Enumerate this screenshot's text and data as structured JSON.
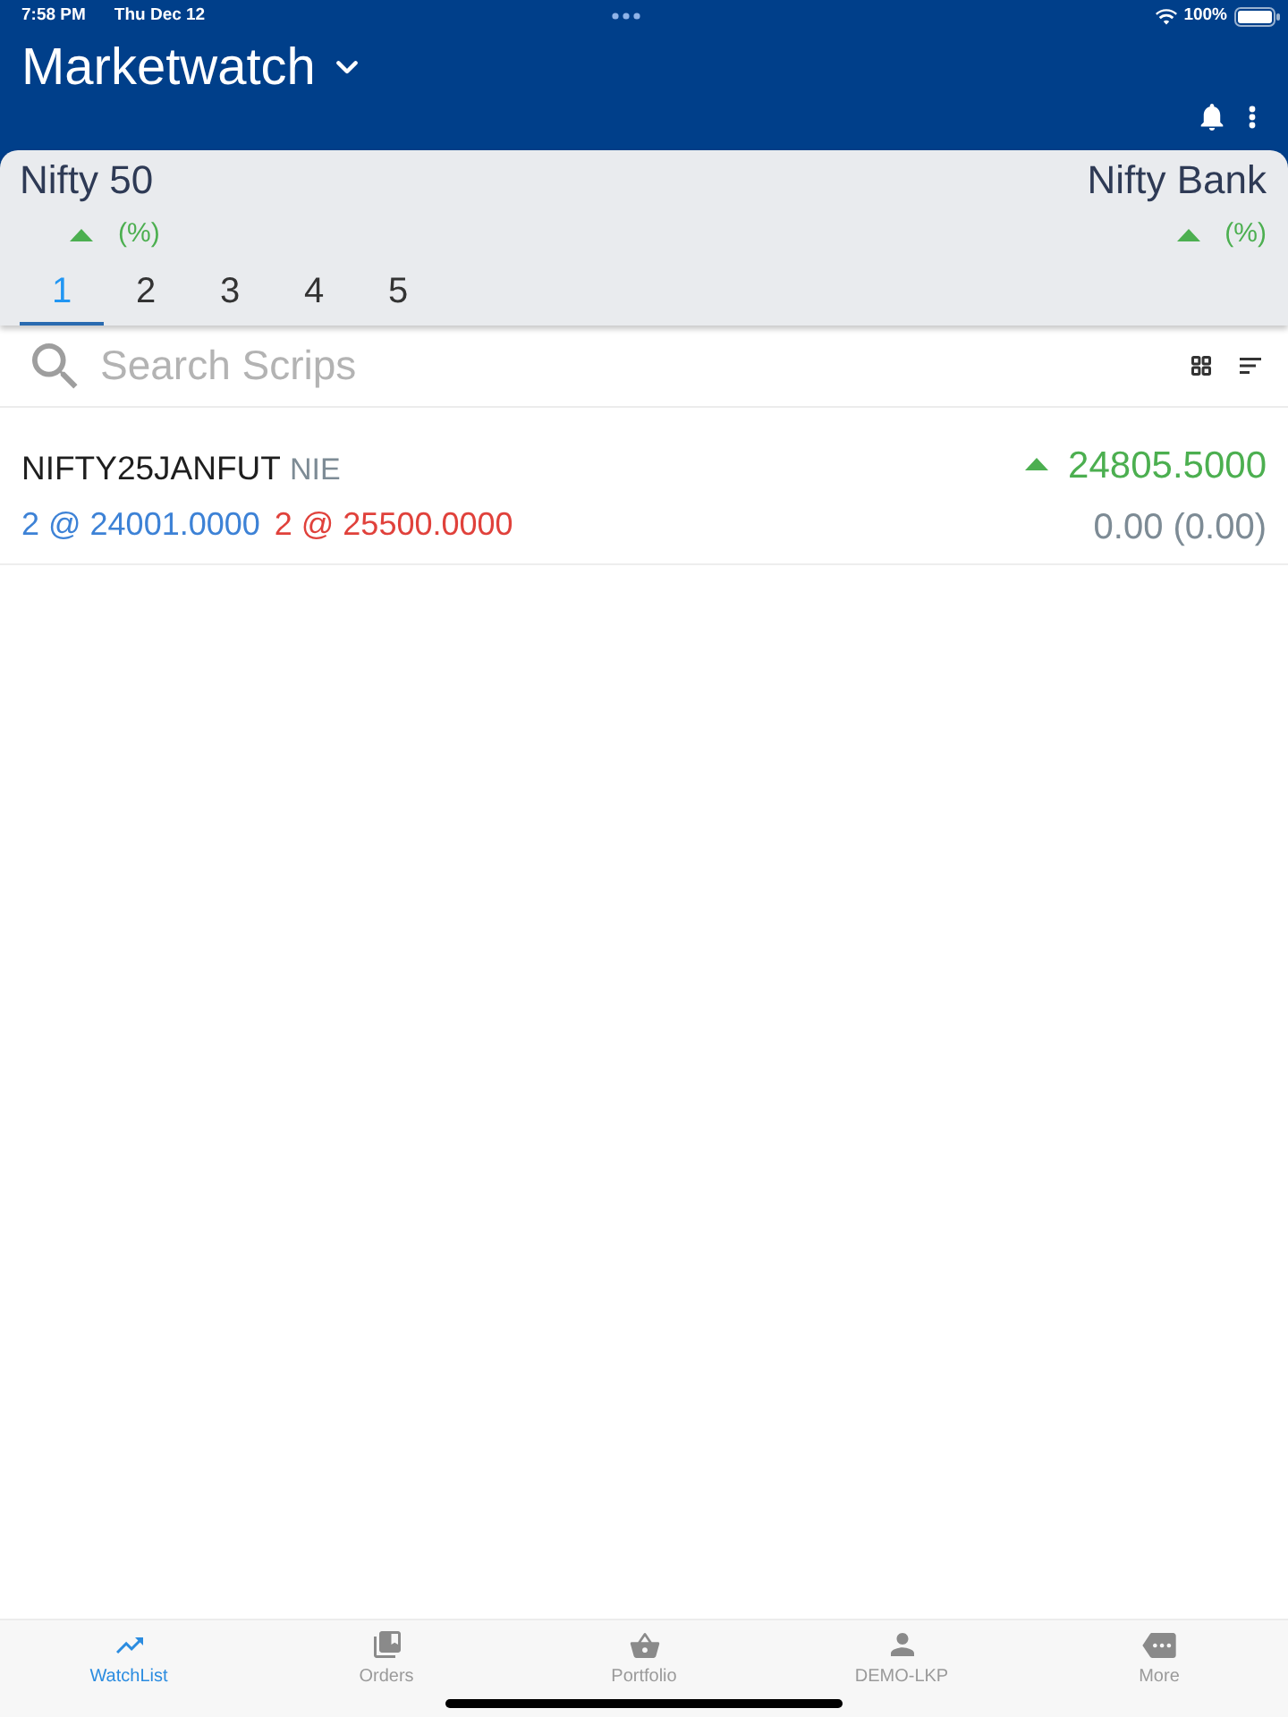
{
  "status_bar": {
    "time": "7:58 PM",
    "date": "Thu Dec 12",
    "battery": "100%"
  },
  "header": {
    "title": "Marketwatch"
  },
  "indices": [
    {
      "name": "Nifty 50",
      "rising": true,
      "change": "(%)"
    },
    {
      "name": "Nifty Bank",
      "rising": true,
      "change": "(%)"
    }
  ],
  "tabs": [
    {
      "label": "1",
      "selected": true
    },
    {
      "label": "2",
      "selected": false
    },
    {
      "label": "3",
      "selected": false
    },
    {
      "label": "4",
      "selected": false
    },
    {
      "label": "5",
      "selected": false
    }
  ],
  "search": {
    "placeholder": "Search Scrips"
  },
  "scrips": [
    {
      "symbol": "NIFTY25JANFUT",
      "exchange": "NIE",
      "bid": "2 @ 24001.0000",
      "ask": "2 @ 25500.0000",
      "rising": true,
      "price": "24805.5000",
      "change": "0.00 (0.00)"
    }
  ],
  "bottom_nav": [
    {
      "kind": "watchlist",
      "label": "WatchList",
      "selected": true
    },
    {
      "kind": "orders",
      "label": "Orders",
      "selected": false
    },
    {
      "kind": "portfolio",
      "label": "Portfolio",
      "selected": false
    },
    {
      "kind": "account",
      "label": "DEMO-LKP",
      "selected": false
    },
    {
      "kind": "more",
      "label": "More",
      "selected": false
    }
  ]
}
